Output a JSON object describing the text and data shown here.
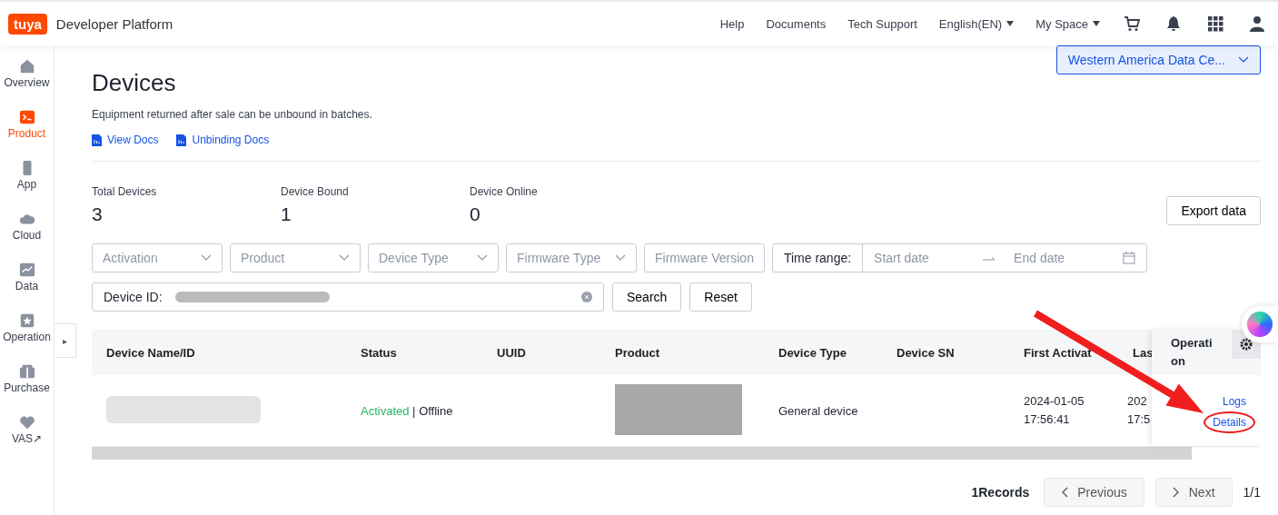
{
  "header": {
    "logo": "tuya",
    "title": "Developer Platform",
    "nav": [
      {
        "label": "Help",
        "dropdown": false
      },
      {
        "label": "Documents",
        "dropdown": false
      },
      {
        "label": "Tech Support",
        "dropdown": false
      },
      {
        "label": "English(EN)",
        "dropdown": true
      },
      {
        "label": "My Space",
        "dropdown": true
      }
    ]
  },
  "sidebar": {
    "items": [
      {
        "label": "Overview",
        "selected": false
      },
      {
        "label": "Product",
        "selected": true
      },
      {
        "label": "App",
        "selected": false
      },
      {
        "label": "Cloud",
        "selected": false
      },
      {
        "label": "Data",
        "selected": false
      },
      {
        "label": "Operation",
        "selected": false
      },
      {
        "label": "Purchase",
        "selected": false
      },
      {
        "label": "VAS↗",
        "selected": false
      }
    ],
    "toggle": "▸"
  },
  "page": {
    "title": "Devices",
    "subtitle": "Equipment returned after sale can be unbound in batches.",
    "links": [
      "View Docs",
      "Unbinding Docs"
    ],
    "region": "Western America Data Ce..."
  },
  "stats": [
    {
      "label": "Total Devices",
      "value": "3"
    },
    {
      "label": "Device Bound",
      "value": "1"
    },
    {
      "label": "Device Online",
      "value": "0"
    }
  ],
  "export_button": "Export data",
  "filters": [
    {
      "kind": "select",
      "placeholder": "Activation"
    },
    {
      "kind": "select",
      "placeholder": "Product"
    },
    {
      "kind": "select",
      "placeholder": "Device Type"
    },
    {
      "kind": "select",
      "placeholder": "Firmware Type"
    },
    {
      "kind": "input",
      "placeholder": "Firmware Version"
    },
    {
      "kind": "daterange",
      "label": "Time range:",
      "start_placeholder": "Start date",
      "end_placeholder": "End date"
    }
  ],
  "search": {
    "label": "Device ID:",
    "buttons": [
      "Search",
      "Reset"
    ]
  },
  "table": {
    "columns": [
      "Device Name/ID",
      "Status",
      "UUID",
      "Product",
      "Device Type",
      "Device SN",
      "First Activat",
      "Las"
    ],
    "operation_column": "Operati on",
    "rows": [
      {
        "activation": "Activated",
        "separator": "|",
        "online": "Offline",
        "device_type": "General device",
        "first_activated": [
          "2024-01-05",
          "17:56:41"
        ],
        "last": [
          "202",
          "17:5"
        ],
        "actions": [
          {
            "label": "Logs",
            "highlighted": false
          },
          {
            "label": "Details",
            "highlighted": true
          }
        ]
      }
    ]
  },
  "pagination": {
    "records": "1Records",
    "previous": "Previous",
    "next": "Next",
    "page": "1/1"
  }
}
